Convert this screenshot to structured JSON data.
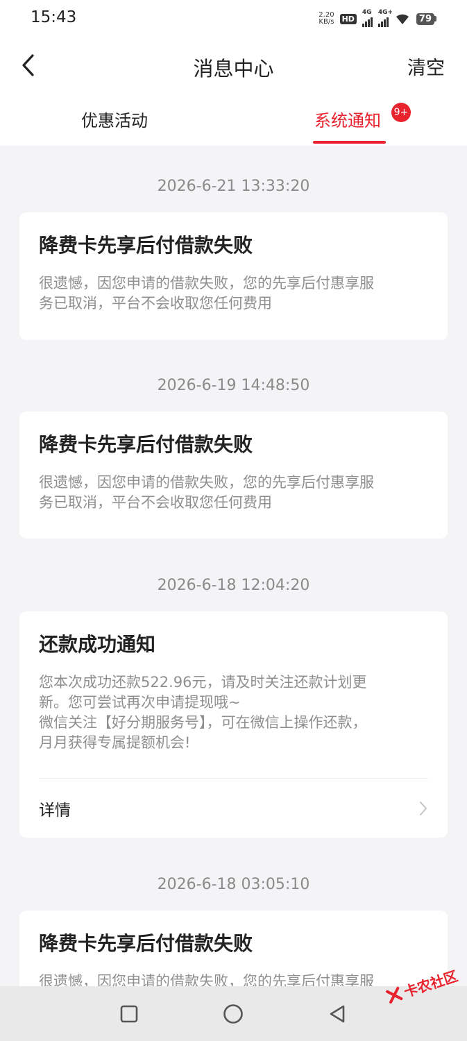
{
  "status_bar": {
    "time": "15:43",
    "net_speed_value": "2.20",
    "net_speed_unit": "KB/s",
    "hd_label": "HD",
    "sim1_label": "4G",
    "sim2_label": "4G+",
    "battery": "79"
  },
  "header": {
    "title": "消息中心",
    "clear_label": "清空"
  },
  "tabs": [
    {
      "label": "优惠活动",
      "active": false
    },
    {
      "label": "系统通知",
      "active": true,
      "badge": "9+"
    }
  ],
  "messages": [
    {
      "date": "2026-6-21 13:33:20",
      "title": "降费卡先享后付借款失败",
      "body_lines": [
        "很遗憾，因您申请的借款失败，您的先享后付惠享服",
        "务已取消，平台不会收取您任何费用"
      ]
    },
    {
      "date": "2026-6-19 14:48:50",
      "title": "降费卡先享后付借款失败",
      "body_lines": [
        "很遗憾，因您申请的借款失败，您的先享后付惠享服",
        "务已取消，平台不会收取您任何费用"
      ]
    },
    {
      "date": "2026-6-18 12:04:20",
      "title": "还款成功通知",
      "body_lines": [
        "您本次成功还款522.96元，请及时关注还款计划更",
        "新。您可尝试再次申请提现哦~",
        "微信关注【好分期服务号】，可在微信上操作还款，",
        "月月获得专属提额机会!"
      ],
      "detail_label": "详情"
    },
    {
      "date": "2026-6-18 03:05:10",
      "title": "降费卡先享后付借款失败",
      "body_lines": [
        "很遗憾，因您申请的借款失败，您的先享后付惠享服"
      ]
    }
  ],
  "watermark": "卡农社区",
  "colors": {
    "accent": "#e8232e",
    "background": "#f4f4f6",
    "muted_text": "#8f8f8f"
  }
}
